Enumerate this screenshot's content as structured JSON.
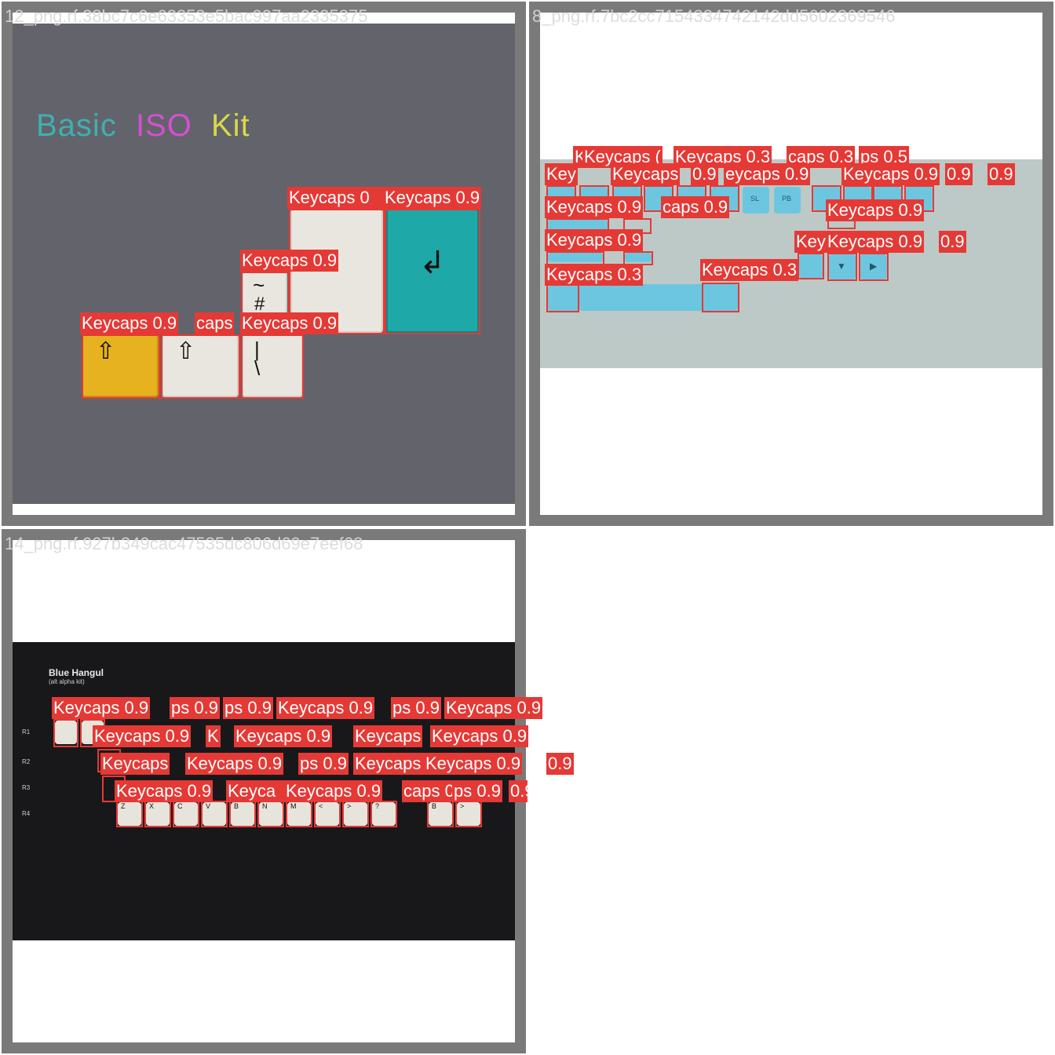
{
  "tiles": [
    {
      "title": "12_png.rf.38bc7c6e63353e5bac997aa2335375"
    },
    {
      "title": "8_png.rf.7bc2cc7154334742142dd5602369546"
    },
    {
      "title": "14_png.rf.927b349cac47535dc806d69e7eef68"
    }
  ],
  "image1": {
    "heading_words": [
      "Basic",
      "ISO",
      "Kit"
    ],
    "heading_colors": [
      "#3fb0b0",
      "#d64fd0",
      "#d8d84a"
    ],
    "background": "#63636b",
    "key_glyphs": {
      "shift": "⇧",
      "enter": "↲",
      "tilde": "~",
      "hash": "#",
      "pipe": "|",
      "backslash": "\\"
    },
    "labels": [
      "Keycaps 0.9",
      "caps",
      "Keycaps 0.9",
      "Keycaps 0.9",
      "Keycaps 0",
      "Keycaps 0.9"
    ]
  },
  "image2": {
    "background": "#bcc9c6",
    "key_color": "#6cc6e0",
    "key_legends": [
      "SL",
      "PB"
    ],
    "arrow_glyphs": [
      "▼",
      "▶"
    ],
    "labels": [
      "K",
      "Keycaps (",
      "Keycaps 0.3",
      "caps 0.3",
      "ps 0.5",
      "Key",
      "Keycaps",
      "0.9",
      "eycaps 0.9",
      "Keycaps 0.9",
      "0.9",
      "0.9",
      "Keycaps 0.9",
      "caps 0.9",
      "Keycaps 0.9",
      "Keycaps 0.9",
      "Key",
      "Keycaps 0.9",
      "0.9",
      "Keycaps 0.3",
      "Keycaps 0.3"
    ]
  },
  "image3": {
    "background": "#18181b",
    "title": "Blue Hangul",
    "subtitle": "(alt alpha kit)",
    "row_labels": [
      "R1",
      "R2",
      "R3",
      "R4"
    ],
    "row4_letters": [
      "Z",
      "X",
      "C",
      "V",
      "B",
      "N",
      "M",
      "<",
      ">",
      "?",
      "B",
      ">"
    ],
    "labels": [
      "Keycaps 0.9",
      "ps 0.9",
      "ps 0.9",
      "Keycaps 0.9",
      "ps 0.9",
      "Keycaps 0.9",
      "Keycaps 0.9",
      "K",
      "Keycaps 0.9",
      "Keycaps",
      "Keycaps 0.9",
      "Keycaps",
      "Keycaps 0.9",
      "ps 0.9",
      "Keycaps",
      "Keycaps 0.9",
      "0.9",
      "Keycaps 0.9",
      "Keyca",
      "Keycaps 0.9",
      "caps 0.9",
      "ps 0.9",
      "0.9"
    ]
  }
}
